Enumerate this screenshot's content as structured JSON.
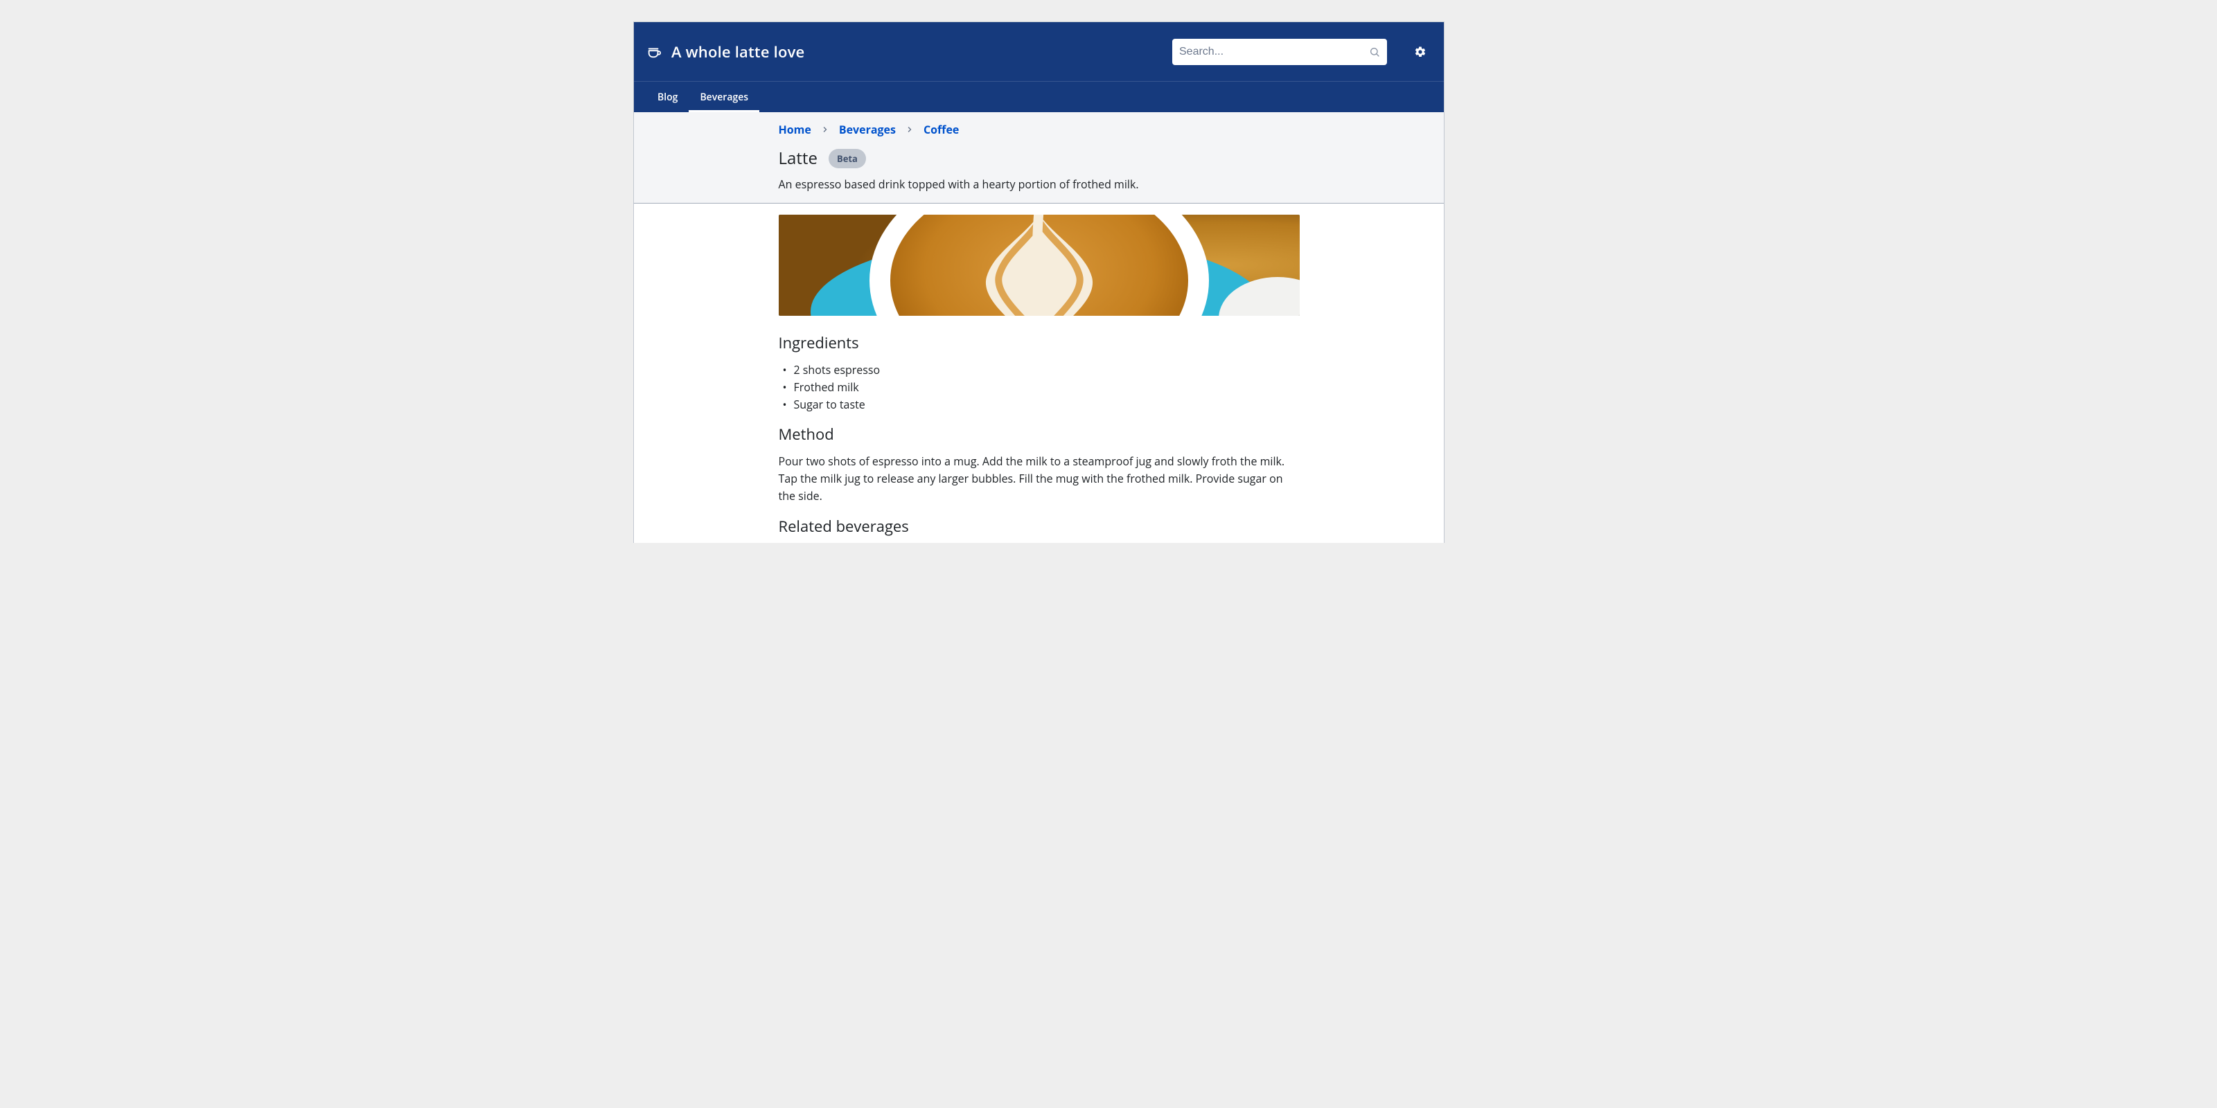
{
  "header": {
    "site_title": "A whole latte love",
    "search_placeholder": "Search..."
  },
  "nav": {
    "items": [
      {
        "label": "Blog",
        "selected": false
      },
      {
        "label": "Beverages",
        "selected": true
      }
    ]
  },
  "breadcrumb": {
    "items": [
      {
        "label": "Home"
      },
      {
        "label": "Beverages"
      },
      {
        "label": "Coffee"
      }
    ]
  },
  "page": {
    "title": "Latte",
    "badge": "Beta",
    "description": "An espresso based drink topped with a hearty portion of frothed milk."
  },
  "sections": {
    "ingredients_heading": "Ingredients",
    "ingredients_items": [
      "2 shots espresso",
      "Frothed milk",
      "Sugar to taste"
    ],
    "method_heading": "Method",
    "method_body": "Pour two shots of espresso into a mug. Add the milk to a steamproof jug and slowly froth the milk. Tap the milk jug to release any larger bubbles. Fill the mug with the frothed milk. Provide sugar on the side.",
    "related_heading": "Related beverages"
  }
}
